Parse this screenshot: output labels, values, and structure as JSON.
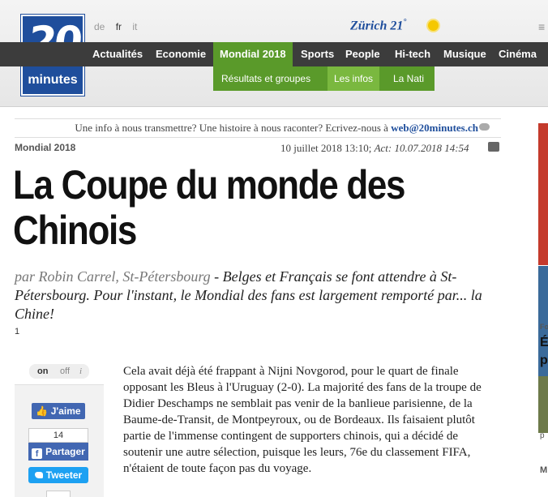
{
  "header": {
    "logo": {
      "number": "20",
      "word": "minutes"
    },
    "languages": [
      {
        "code": "de",
        "active": false
      },
      {
        "code": "fr",
        "active": true
      },
      {
        "code": "it",
        "active": false
      }
    ],
    "weather": {
      "city": "Zürich",
      "temp": "21",
      "unit": "°",
      "icon": "sun-icon"
    },
    "menu_icon": "hamburger-icon"
  },
  "nav": {
    "items": [
      {
        "label": "Actualités"
      },
      {
        "label": "Economie"
      },
      {
        "label": "Mondial 2018",
        "active": true
      },
      {
        "label": "Sports"
      },
      {
        "label": "People"
      },
      {
        "label": "Hi-tech"
      },
      {
        "label": "Musique"
      },
      {
        "label": "Cinéma"
      }
    ],
    "active_color": "#5a9a2a",
    "subnav": [
      {
        "label": "Résultats et groupes"
      },
      {
        "label": "Les infos",
        "active": true
      },
      {
        "label": "La Nati"
      }
    ]
  },
  "infobar": {
    "text": "Une info à nous transmettre? Une histoire à nous raconter? Ecrivez-nous à ",
    "email": "web@20minutes.ch"
  },
  "article": {
    "rubric": "Mondial 2018",
    "date": "10 juillet 2018 13:10; ",
    "updated": "Act: 10.07.2018 14:54",
    "title": "La Coupe du monde des Chinois",
    "author": "par Robin Carrel, St-Pétersbourg",
    "lead": " - Belges et Français se font attendre à St-Pétersbourg. Pour l'instant, le Mondial des fans est largement remporté par... la Chine!",
    "lead_count": "1",
    "body": "Cela avait déjà été frappant à Nijni Novgorod, pour le quart de finale opposant les Bleus à l'Uruguay (2-0). La majorité des fans de la troupe de Didier Deschamps ne semblait pas venir de la banlieue parisienne, de la Baume-de-Transit, de Montpeyroux, ou de Bordeaux. Ils faisaient plutôt partie de l'immense contingent de supporters chinois, qui a décidé de soutenir une autre sélection, puisque les leurs, 76e du classement FIFA, n'étaient de toute façon pas du voyage."
  },
  "social": {
    "toggle_on": "on",
    "toggle_off": "off",
    "toggle_info": "i",
    "like_label": "J'aime",
    "share_count": "14",
    "share_label": "Partager",
    "tweet_label": "Tweeter"
  },
  "right_column": {
    "letters": [
      "Fo",
      "É",
      "p",
      "p",
      "M"
    ]
  }
}
